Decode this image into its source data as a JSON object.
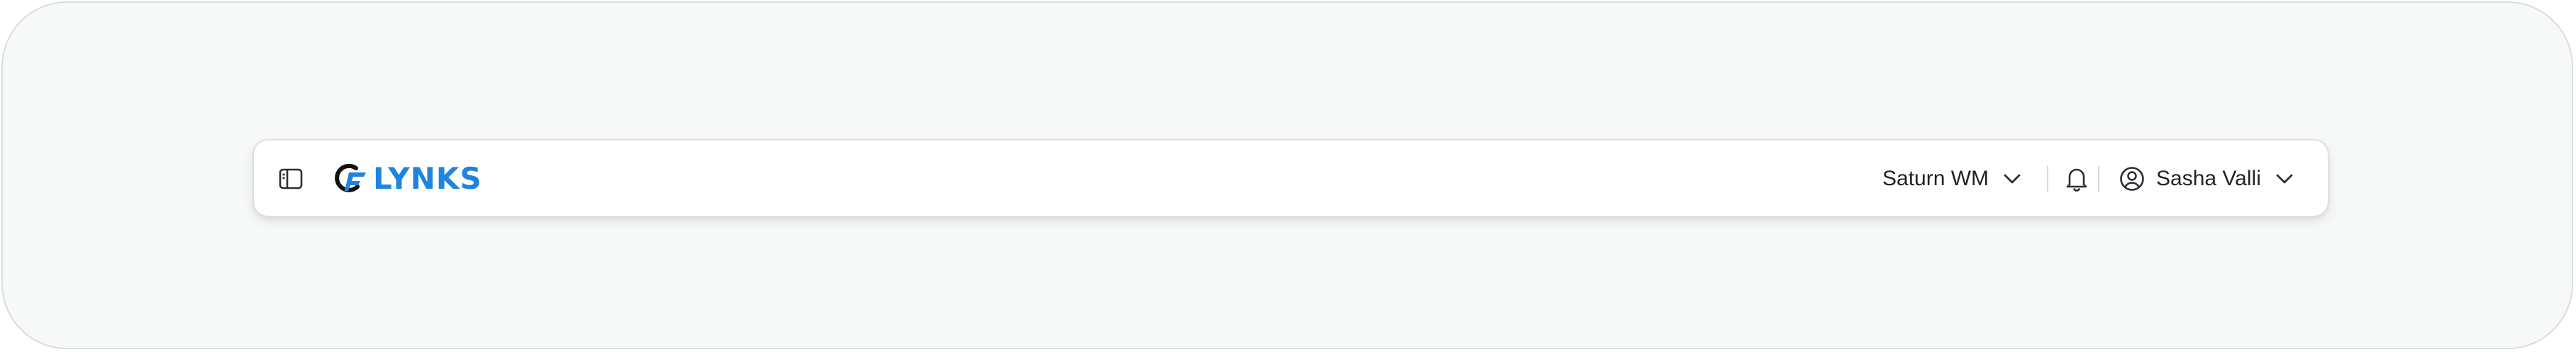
{
  "header": {
    "logo_text": "LYNKS",
    "workspace_label": "Saturn WM",
    "user_name": "Sasha Valli"
  },
  "colors": {
    "brand": "#1f84e0",
    "text": "#1f2328",
    "background": "#f7f9f8"
  },
  "icons": {
    "sidebar_toggle": "sidebar-panel-icon",
    "logo_mark": "lynks-logo-mark",
    "workspace_dropdown": "chevron-down-icon",
    "notifications": "bell-icon",
    "user": "user-circle-icon",
    "user_dropdown": "chevron-down-icon"
  }
}
